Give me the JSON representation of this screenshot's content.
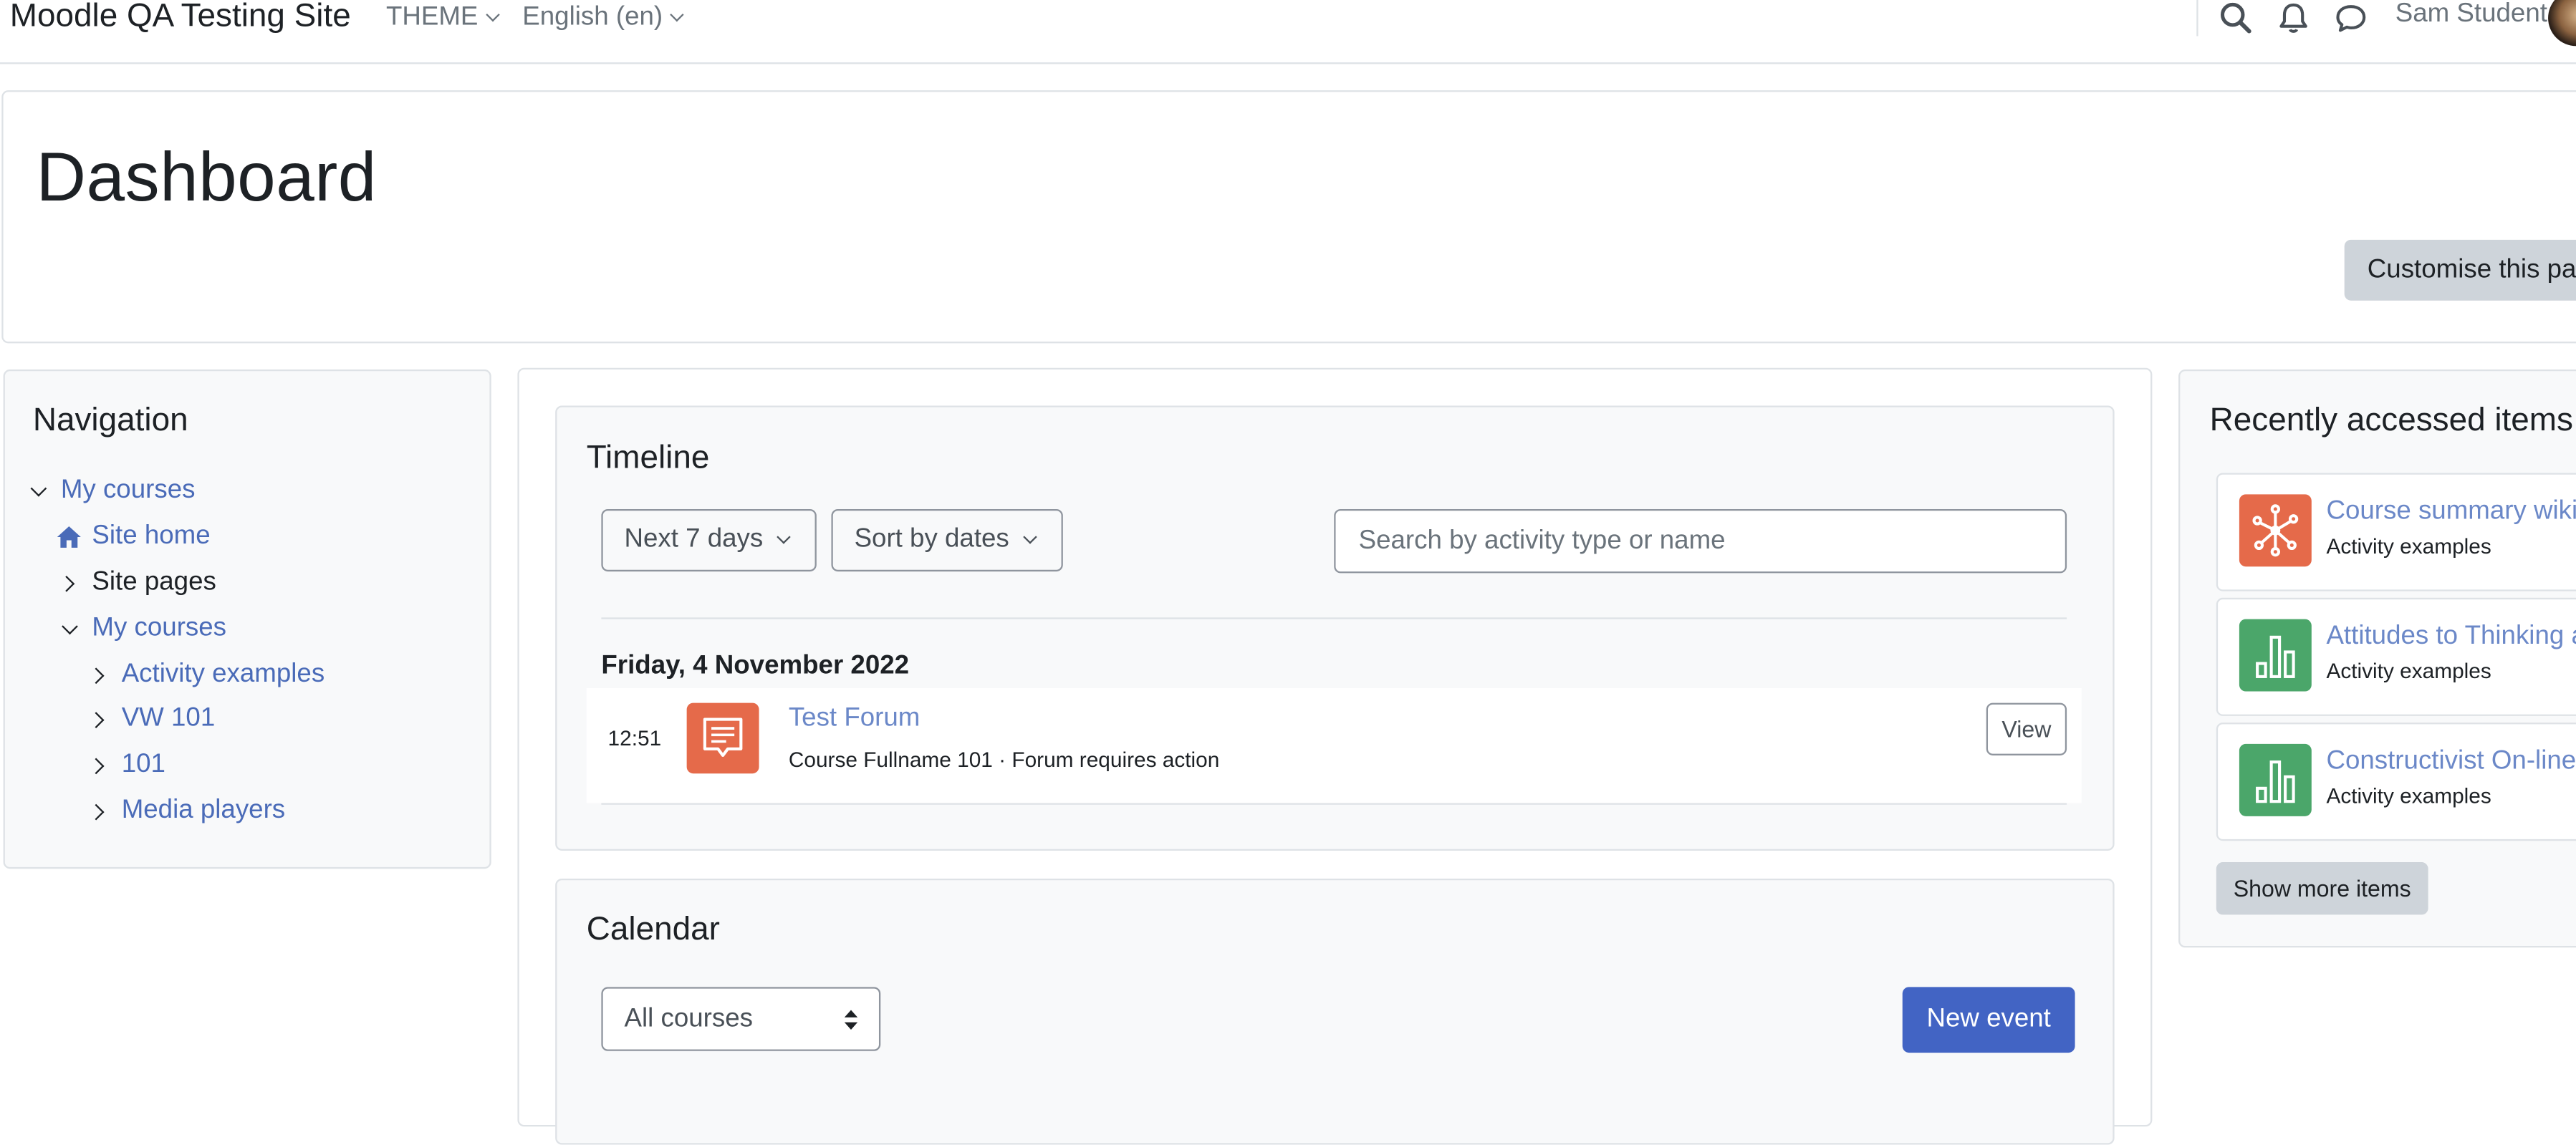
{
  "navbar": {
    "brand": "Moodle QA Testing Site",
    "theme_menu": "THEME",
    "language_menu": "English (en)",
    "user_name": "Sam Student"
  },
  "header": {
    "title": "Dashboard",
    "customise_button": "Customise this pa"
  },
  "navigation": {
    "title": "Navigation",
    "items": [
      {
        "label": "My courses"
      },
      {
        "label": "Site home"
      },
      {
        "label": "Site pages"
      },
      {
        "label": "My courses"
      },
      {
        "label": "Activity examples"
      },
      {
        "label": "VW 101"
      },
      {
        "label": "101"
      },
      {
        "label": "Media players"
      }
    ]
  },
  "timeline": {
    "title": "Timeline",
    "filter_days": "Next 7 days",
    "sort": "Sort by dates",
    "search_placeholder": "Search by activity type or name",
    "date_heading": "Friday, 4 November 2022",
    "event": {
      "time": "12:51",
      "name": "Test Forum",
      "details": "Course Fullname 101 · Forum requires action",
      "action": "View"
    }
  },
  "calendar": {
    "title": "Calendar",
    "course_select": "All courses",
    "new_event": "New event"
  },
  "recent": {
    "title": "Recently accessed items",
    "items": [
      {
        "name": "Course summary wiki",
        "course": "Activity examples",
        "icon": "wiki-icon",
        "color": "#e56a4a"
      },
      {
        "name": "Attitudes to Thinking a",
        "course": "Activity examples",
        "icon": "survey-chart-icon",
        "color": "#4ba66a"
      },
      {
        "name": "Constructivist On-line",
        "course": "Activity examples",
        "icon": "survey-chart-icon",
        "color": "#4ba66a"
      }
    ],
    "show_more": "Show more items"
  },
  "colors": {
    "link": "#4a6bb8",
    "primary_button": "#4264c4",
    "forum_icon_bg": "#e56a4a",
    "survey_icon_bg": "#4ba66a"
  }
}
